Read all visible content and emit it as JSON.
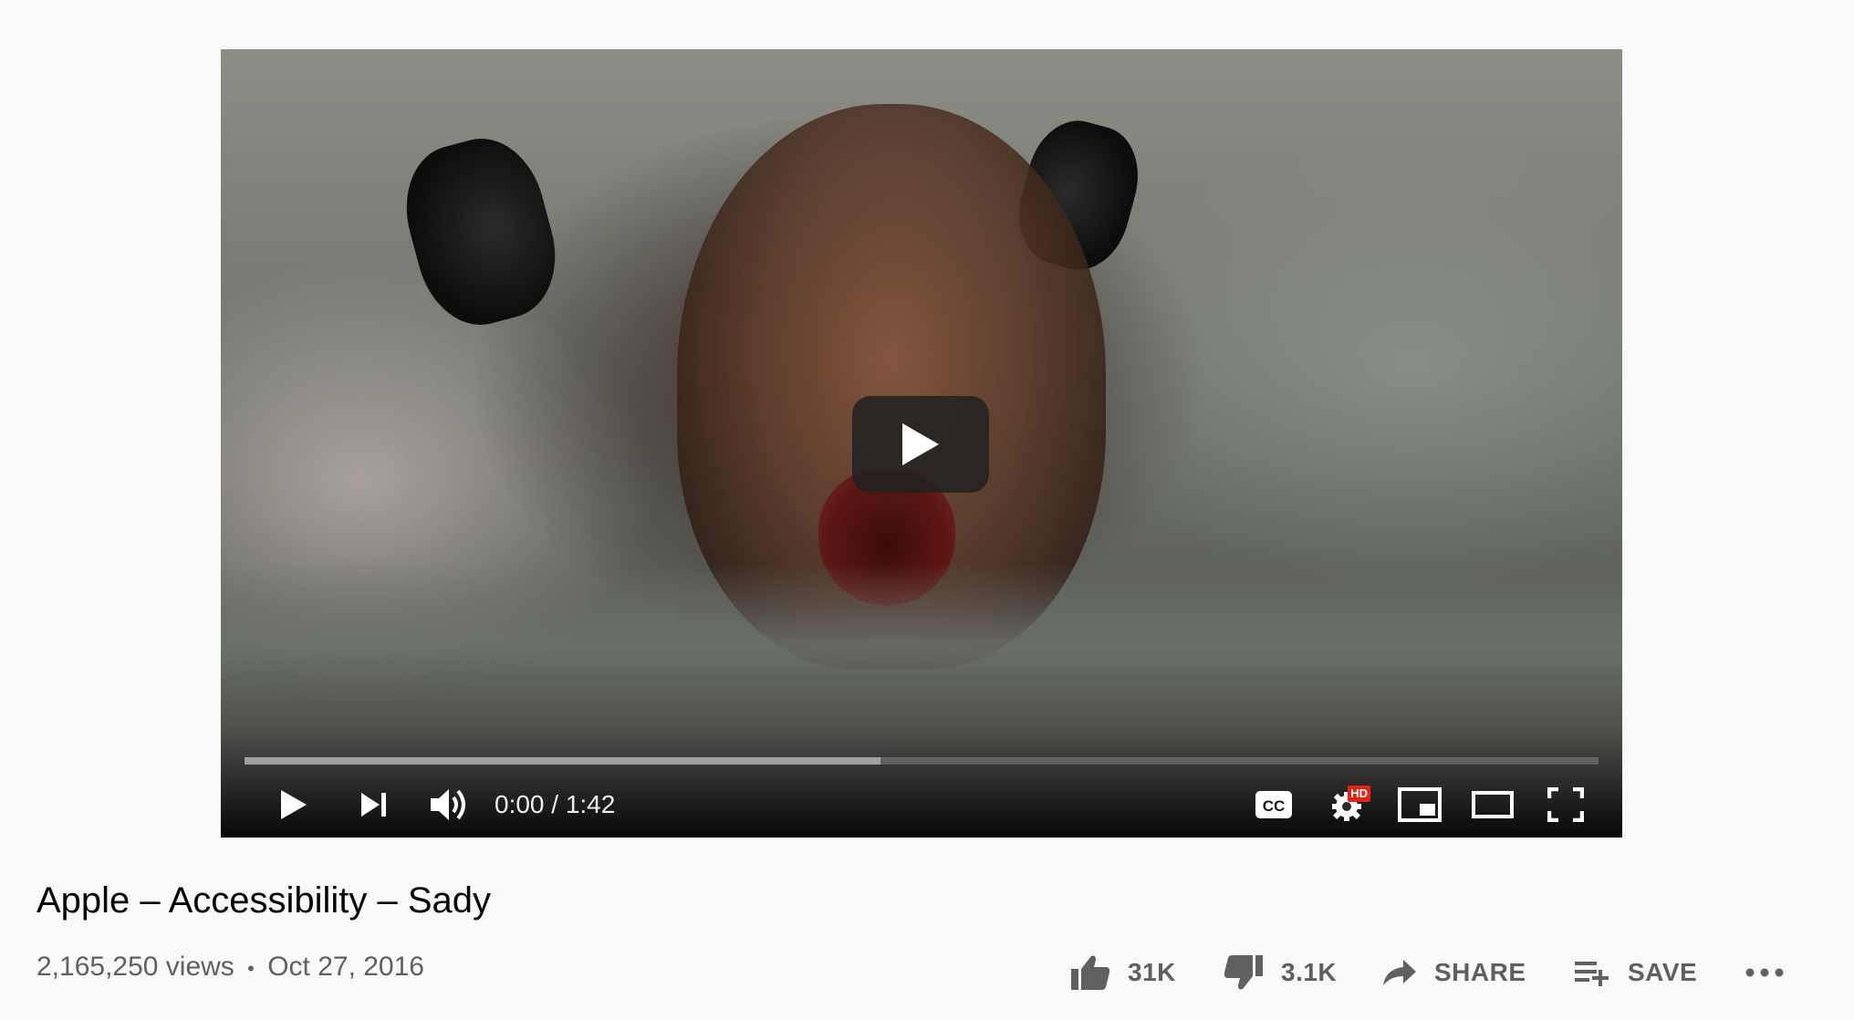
{
  "player": {
    "time_display": "0:00 / 1:42",
    "progress_loaded_fraction": 0.47,
    "hd_badge": "HD",
    "icons": {
      "big_play": "play-icon",
      "play": "play-icon",
      "next": "skip-next-icon",
      "volume": "volume-icon",
      "captions": "captions-icon",
      "settings": "settings-gear-icon",
      "miniplayer": "miniplayer-icon",
      "theater": "theater-mode-icon",
      "fullscreen": "fullscreen-icon"
    }
  },
  "video": {
    "title": "Apple – Accessibility – Sady",
    "views": "2,165,250 views",
    "separator": "•",
    "date": "Oct 27, 2016"
  },
  "actions": {
    "like_count": "31K",
    "dislike_count": "3.1K",
    "share_label": "SHARE",
    "save_label": "SAVE",
    "icons": {
      "like": "thumbs-up-icon",
      "dislike": "thumbs-down-icon",
      "share": "share-arrow-icon",
      "save": "playlist-add-icon",
      "more": "more-horizontal-icon"
    }
  },
  "colors": {
    "page_background": "#f9f9f9",
    "title_text": "#030303",
    "secondary_text": "#606060",
    "hd_badge": "#e62117"
  }
}
